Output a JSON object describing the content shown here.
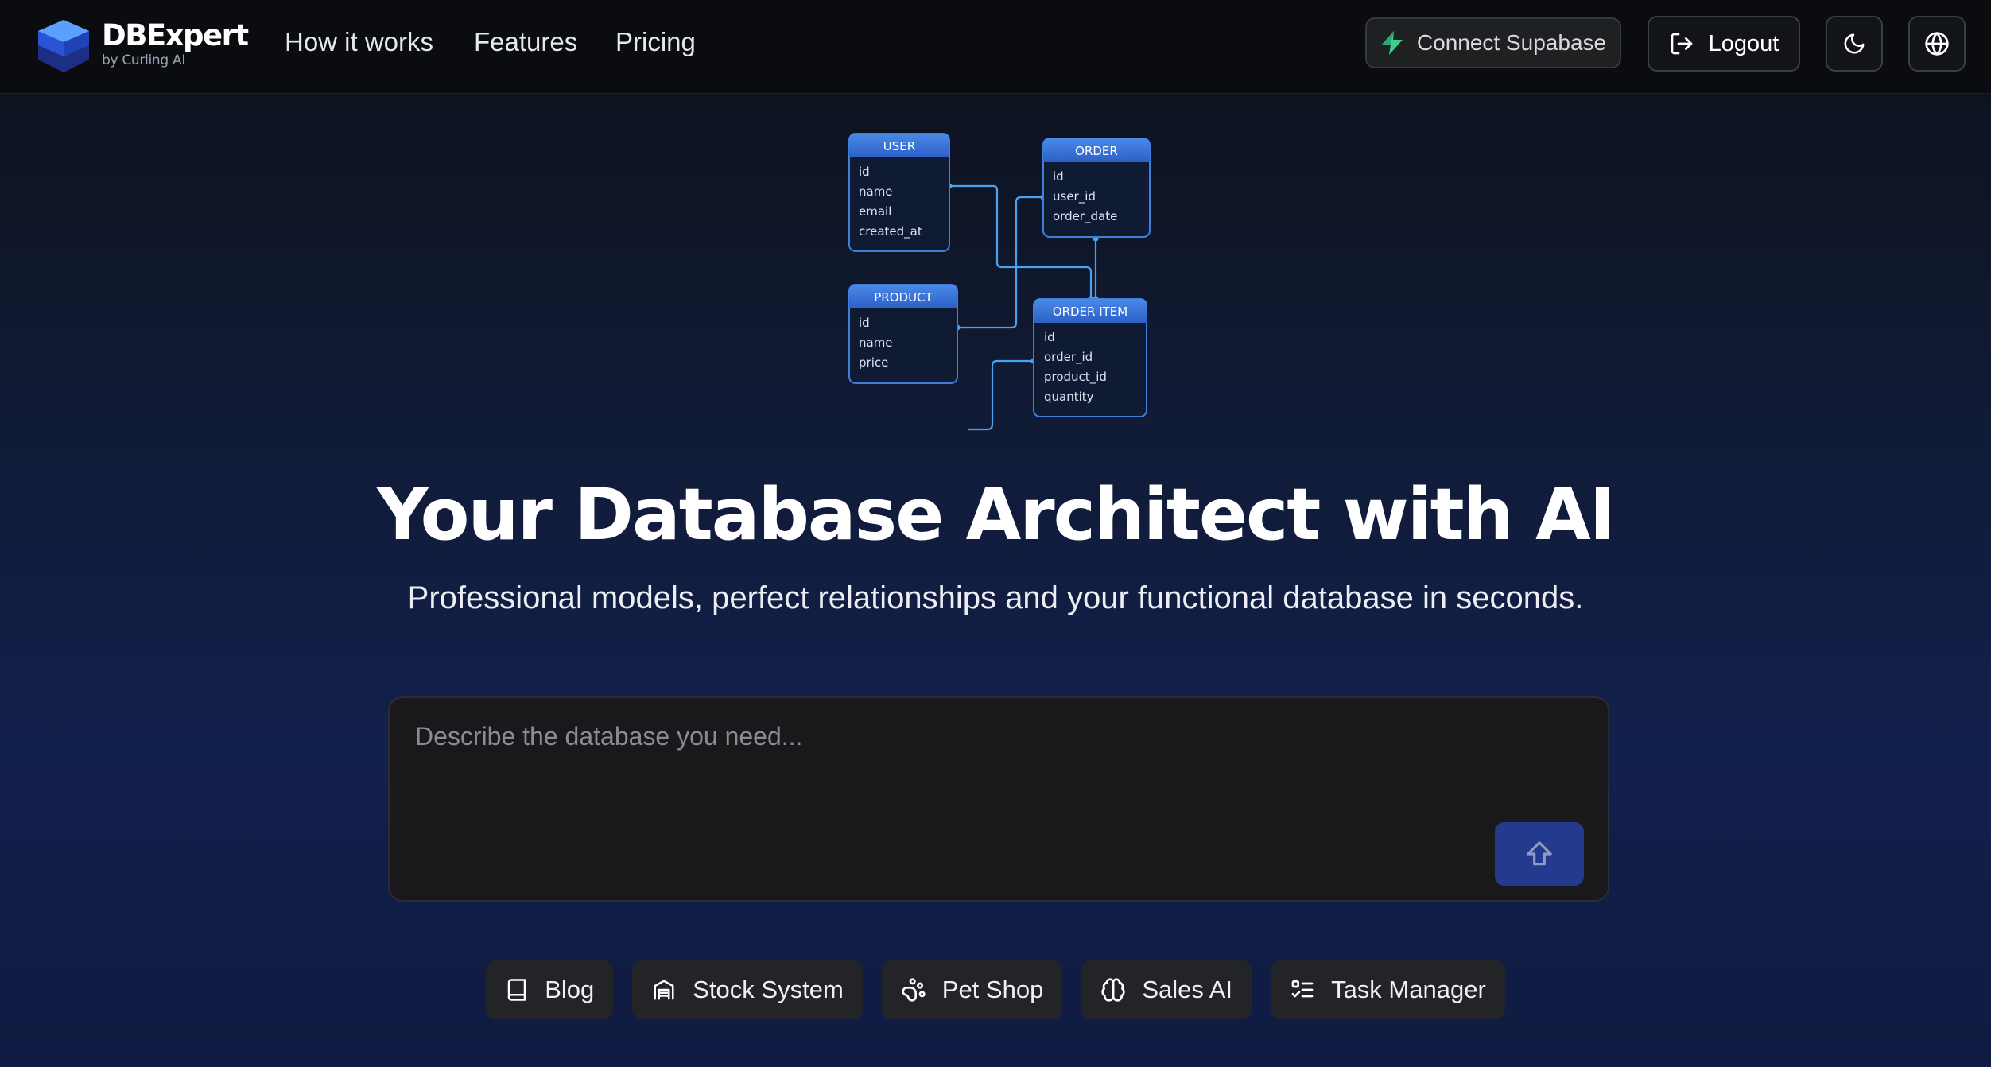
{
  "brand": {
    "name": "DBExpert",
    "tagline": "by Curling AI",
    "accent_color": "#3b82f6"
  },
  "nav": {
    "links": [
      {
        "label": "How it works"
      },
      {
        "label": "Features"
      },
      {
        "label": "Pricing"
      }
    ]
  },
  "header_actions": {
    "supabase_label": "Connect Supabase",
    "supabase_icon": "bolt-icon",
    "supabase_color": "#3ecf8e",
    "logout_label": "Logout",
    "logout_icon": "logout-icon",
    "theme_icon": "moon-icon",
    "language_icon": "globe-icon"
  },
  "diagram": {
    "tables": [
      {
        "name": "USER",
        "fields": [
          "id",
          "name",
          "email",
          "created_at"
        ]
      },
      {
        "name": "ORDER",
        "fields": [
          "id",
          "user_id",
          "order_date"
        ]
      },
      {
        "name": "PRODUCT",
        "fields": [
          "id",
          "name",
          "price"
        ]
      },
      {
        "name": "ORDER ITEM",
        "fields": [
          "id",
          "order_id",
          "product_id",
          "quantity"
        ]
      }
    ]
  },
  "hero": {
    "title": "Your Database Architect with AI",
    "subtitle": "Professional models, perfect relationships and your functional database in seconds."
  },
  "prompt": {
    "placeholder": "Describe the database you need...",
    "value": "",
    "submit_icon": "arrow-up-icon",
    "submit_color": "#233a8f"
  },
  "examples": [
    {
      "label": "Blog",
      "icon": "book-icon"
    },
    {
      "label": "Stock System",
      "icon": "warehouse-icon"
    },
    {
      "label": "Pet Shop",
      "icon": "paw-icon"
    },
    {
      "label": "Sales AI",
      "icon": "brain-icon"
    },
    {
      "label": "Task Manager",
      "icon": "checklist-icon"
    }
  ]
}
